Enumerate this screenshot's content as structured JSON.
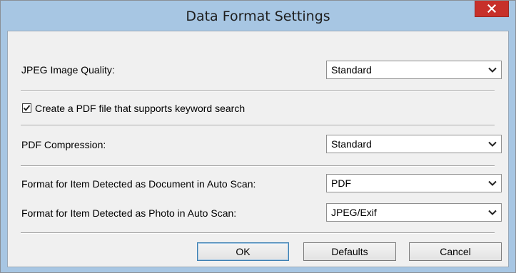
{
  "window": {
    "title": "Data Format Settings"
  },
  "fields": {
    "jpeg_quality": {
      "label": "JPEG Image Quality:",
      "value": "Standard"
    },
    "keyword_search": {
      "label": "Create a PDF file that supports keyword search",
      "checked": true
    },
    "pdf_compression": {
      "label": "PDF Compression:",
      "value": "Standard"
    },
    "document_format": {
      "label": "Format for Item Detected as Document in Auto Scan:",
      "value": "PDF"
    },
    "photo_format": {
      "label": "Format for Item Detected as Photo in Auto Scan:",
      "value": "JPEG/Exif"
    }
  },
  "buttons": {
    "ok": "OK",
    "defaults": "Defaults",
    "cancel": "Cancel"
  },
  "icons": {
    "close": "close-icon",
    "dropdown": "chevron-down-icon",
    "check": "checkmark-icon"
  },
  "colors": {
    "titlebar": "#a7c6e3",
    "close_button": "#c7302a",
    "panel": "#f0f0f0"
  }
}
